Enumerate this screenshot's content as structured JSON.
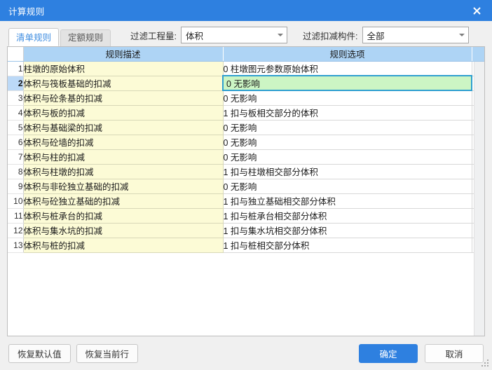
{
  "window": {
    "title": "计算规则",
    "close_icon": "close-icon",
    "accent_color": "#2e80e0"
  },
  "toolbar": {
    "tabs": [
      {
        "label": "清单规则",
        "active": true
      },
      {
        "label": "定额规则",
        "active": false
      }
    ],
    "filters": [
      {
        "label": "过滤工程量:",
        "value": "体积",
        "arrow_icon": "chevron-down-icon"
      },
      {
        "label": "过滤扣减构件:",
        "value": "全部",
        "arrow_icon": "chevron-down-icon"
      }
    ]
  },
  "grid": {
    "headers": {
      "num": "",
      "description": "规则描述",
      "option": "规则选项"
    },
    "selected_row": 2,
    "rows": [
      {
        "num": "1",
        "description": "柱墩的原始体积",
        "option": "0 柱墩图元参数原始体积"
      },
      {
        "num": "2",
        "description": "体积与筏板基础的扣减",
        "option": "0  无影响"
      },
      {
        "num": "3",
        "description": "体积与砼条基的扣减",
        "option": "0  无影响"
      },
      {
        "num": "4",
        "description": "体积与板的扣减",
        "option": "1 扣与板相交部分的体积"
      },
      {
        "num": "5",
        "description": "体积与基础梁的扣减",
        "option": "0  无影响"
      },
      {
        "num": "6",
        "description": "体积与砼墙的扣减",
        "option": "0  无影响"
      },
      {
        "num": "7",
        "description": "体积与柱的扣减",
        "option": "0  无影响"
      },
      {
        "num": "8",
        "description": "体积与柱墩的扣减",
        "option": "1 扣与柱墩相交部分体积"
      },
      {
        "num": "9",
        "description": "体积与非砼独立基础的扣减",
        "option": "0  无影响"
      },
      {
        "num": "10",
        "description": "体积与砼独立基础的扣减",
        "option": "1 扣与独立基础相交部分体积"
      },
      {
        "num": "11",
        "description": "体积与桩承台的扣减",
        "option": "1 扣与桩承台相交部分体积"
      },
      {
        "num": "12",
        "description": "体积与集水坑的扣减",
        "option": "1 扣与集水坑相交部分体积"
      },
      {
        "num": "13",
        "description": "体积与桩的扣减",
        "option": "1 扣与桩相交部分体积"
      }
    ]
  },
  "footer": {
    "restore_default_label": "恢复默认值",
    "restore_current_row_label": "恢复当前行",
    "ok_label": "确定",
    "cancel_label": "取消"
  }
}
